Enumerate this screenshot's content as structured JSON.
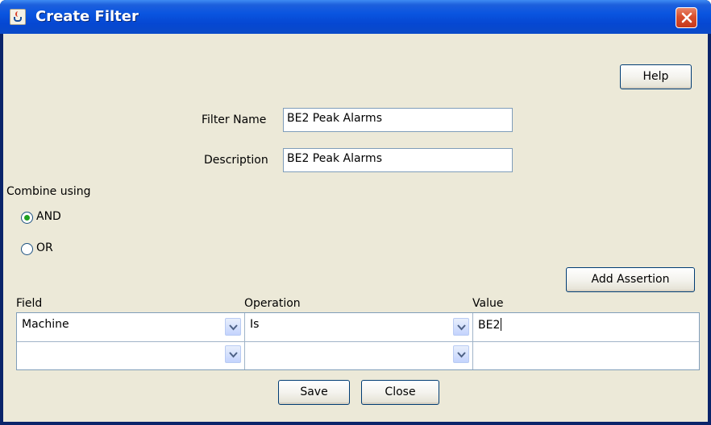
{
  "window": {
    "title": "Create Filter"
  },
  "buttons": {
    "help": "Help",
    "add_assertion": "Add Assertion",
    "save": "Save",
    "close": "Close"
  },
  "form": {
    "filter_name_label": "Filter Name",
    "filter_name_value": "BE2 Peak Alarms",
    "description_label": "Description",
    "description_value": "BE2 Peak Alarms",
    "combine_label": "Combine using",
    "options": [
      {
        "label": "AND",
        "selected": true
      },
      {
        "label": "OR",
        "selected": false
      }
    ]
  },
  "table": {
    "headers": [
      "Field",
      "Operation",
      "Value"
    ],
    "rows": [
      {
        "field": "Machine",
        "operation": "Is",
        "value": "BE2"
      },
      {
        "field": "",
        "operation": "",
        "value": ""
      }
    ]
  },
  "icons": {
    "window_icon": "java-cup-icon",
    "close": "close-icon",
    "dropdown": "chevron-down-icon"
  },
  "colors": {
    "titlebar": "#0a55e0",
    "dialog_bg": "#ece9d8",
    "radio_selected": "#21a121",
    "close_button": "#d9502d"
  }
}
